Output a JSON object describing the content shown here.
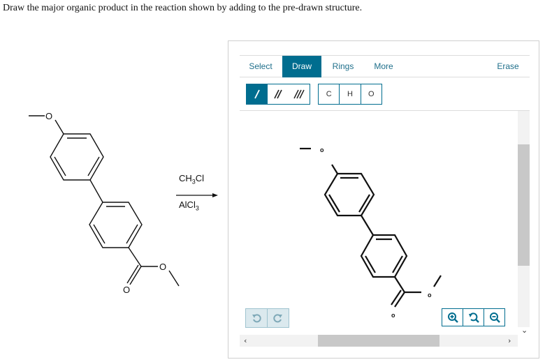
{
  "question": {
    "text": "Draw the major organic product in the reaction shown by adding to the pre-drawn structure."
  },
  "reactant": {
    "atom_labels": [
      "O",
      "O",
      "O"
    ]
  },
  "reagents": {
    "line1": {
      "main": "CH",
      "sub": "3",
      "tail": "Cl"
    },
    "line2": {
      "main": "AlCl",
      "sub": "3"
    }
  },
  "editor": {
    "tabs": [
      {
        "label": "Select",
        "active": false
      },
      {
        "label": "Draw",
        "active": true
      },
      {
        "label": "Rings",
        "active": false
      },
      {
        "label": "More",
        "active": false
      },
      {
        "label": "Erase",
        "active": false
      }
    ],
    "bond_tools": [
      "single-bond",
      "double-bond",
      "triple-bond"
    ],
    "atom_tools": [
      "C",
      "H",
      "O"
    ],
    "canvas_atom_labels": [
      "o",
      "o",
      "o"
    ],
    "colors": {
      "accent": "#006d8f",
      "inactive_button_bg": "#dbe9ee"
    },
    "icons": [
      "undo-icon",
      "redo-icon",
      "zoom-in-icon",
      "zoom-reset-icon",
      "zoom-out-icon"
    ]
  }
}
